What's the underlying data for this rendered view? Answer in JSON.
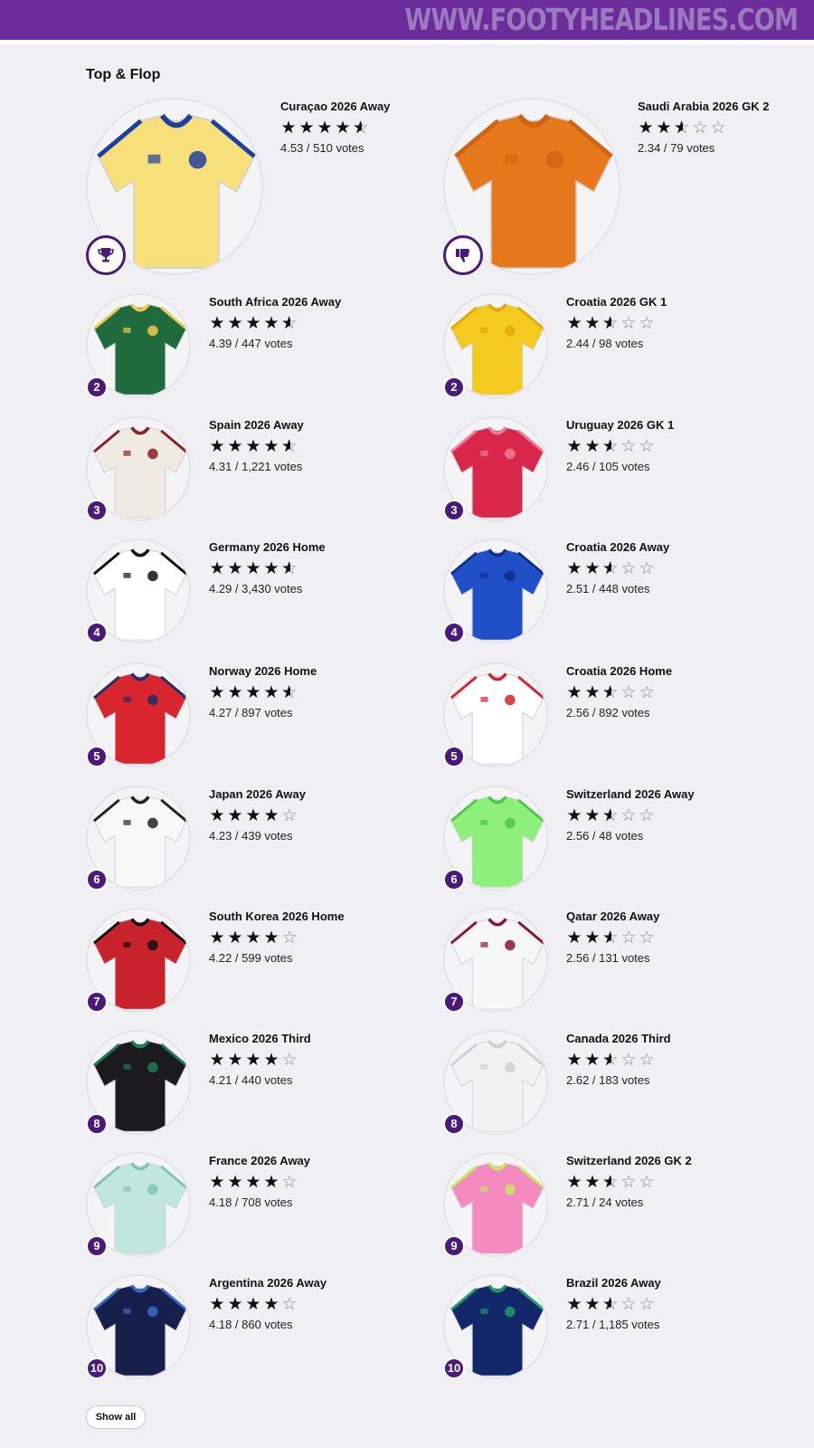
{
  "watermark": "WWW.FOOTYHEADLINES.COM",
  "section_title": "Top & Flop",
  "show_all_label": "Show all",
  "icons": {
    "top_badge": "trophy-icon",
    "flop_badge": "thumbs-down-icon"
  },
  "colors": {
    "brand": "#6a2d9a",
    "badge": "#4a1a7a"
  },
  "top": [
    {
      "rank": "",
      "name": "Curaçao 2026 Away",
      "rating": 4.53,
      "votes": "4.53 / 510 votes",
      "shirt": "#f7e07a",
      "trim": "#1d3fa0"
    },
    {
      "rank": "2",
      "name": "South Africa 2026 Away",
      "rating": 4.39,
      "votes": "4.39 / 447 votes",
      "shirt": "#1f6b3e",
      "trim": "#f2c94c"
    },
    {
      "rank": "3",
      "name": "Spain 2026 Away",
      "rating": 4.31,
      "votes": "4.31 / 1,221 votes",
      "shirt": "#efebe2",
      "trim": "#8a1f24"
    },
    {
      "rank": "4",
      "name": "Germany 2026 Home",
      "rating": 4.29,
      "votes": "4.29 / 3,430 votes",
      "shirt": "#ffffff",
      "trim": "#111111"
    },
    {
      "rank": "5",
      "name": "Norway 2026 Home",
      "rating": 4.27,
      "votes": "4.27 / 897 votes",
      "shirt": "#d8252e",
      "trim": "#1c2e6e"
    },
    {
      "rank": "6",
      "name": "Japan 2026 Away",
      "rating": 4.23,
      "votes": "4.23 / 439 votes",
      "shirt": "#f8f8f8",
      "trim": "#222222"
    },
    {
      "rank": "7",
      "name": "South Korea 2026 Home",
      "rating": 4.22,
      "votes": "4.22 / 599 votes",
      "shirt": "#c8232c",
      "trim": "#111111"
    },
    {
      "rank": "8",
      "name": "Mexico 2026 Third",
      "rating": 4.21,
      "votes": "4.21 / 440 votes",
      "shirt": "#1b1b1d",
      "trim": "#1e7b5a"
    },
    {
      "rank": "9",
      "name": "France 2026 Away",
      "rating": 4.18,
      "votes": "4.18 / 708 votes",
      "shirt": "#bfe7de",
      "trim": "#7fc4b6"
    },
    {
      "rank": "10",
      "name": "Argentina 2026 Away",
      "rating": 4.18,
      "votes": "4.18 / 860 votes",
      "shirt": "#16204a",
      "trim": "#3a68c8"
    }
  ],
  "flop": [
    {
      "rank": "",
      "name": "Saudi Arabia 2026 GK 2",
      "rating": 2.34,
      "votes": "2.34 / 79 votes",
      "shirt": "#e8781c",
      "trim": "#cf6412"
    },
    {
      "rank": "2",
      "name": "Croatia 2026 GK 1",
      "rating": 2.44,
      "votes": "2.44 / 98 votes",
      "shirt": "#f4c920",
      "trim": "#e0a90a"
    },
    {
      "rank": "3",
      "name": "Uruguay 2026 GK 1",
      "rating": 2.46,
      "votes": "2.46 / 105 votes",
      "shirt": "#d8274a",
      "trim": "#f07a98"
    },
    {
      "rank": "4",
      "name": "Croatia 2026 Away",
      "rating": 2.51,
      "votes": "2.51 / 448 votes",
      "shirt": "#1f4fc9",
      "trim": "#0f2f8a"
    },
    {
      "rank": "5",
      "name": "Croatia 2026 Home",
      "rating": 2.56,
      "votes": "2.56 / 892 votes",
      "shirt": "#ffffff",
      "trim": "#d9222e"
    },
    {
      "rank": "6",
      "name": "Switzerland 2026 Away",
      "rating": 2.56,
      "votes": "2.56 / 48 votes",
      "shirt": "#8ef07a",
      "trim": "#4cc94a"
    },
    {
      "rank": "7",
      "name": "Qatar 2026 Away",
      "rating": 2.56,
      "votes": "2.56 / 131 votes",
      "shirt": "#f7f7f7",
      "trim": "#8a1538"
    },
    {
      "rank": "8",
      "name": "Canada 2026 Third",
      "rating": 2.62,
      "votes": "2.62 / 183 votes",
      "shirt": "#f2f2f2",
      "trim": "#d0d0d0"
    },
    {
      "rank": "9",
      "name": "Switzerland 2026 GK 2",
      "rating": 2.71,
      "votes": "2.71 / 24 votes",
      "shirt": "#f58ac0",
      "trim": "#c9e85a"
    },
    {
      "rank": "10",
      "name": "Brazil 2026 Away",
      "rating": 2.71,
      "votes": "2.71 / 1,185 votes",
      "shirt": "#13276b",
      "trim": "#1f9a6a"
    }
  ]
}
